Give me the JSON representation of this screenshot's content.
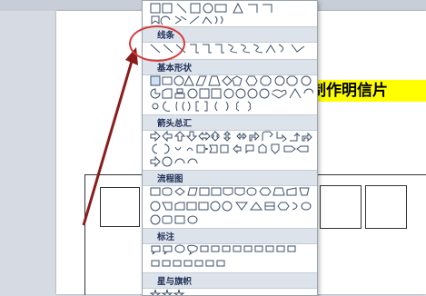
{
  "document": {
    "title_text": "制作明信片"
  },
  "shapes_menu": {
    "sections": [
      {
        "label": "线条"
      },
      {
        "label": "基本形状"
      },
      {
        "label": "箭头总汇"
      },
      {
        "label": "流程图"
      },
      {
        "label": "标注"
      },
      {
        "label": "星与旗帜"
      }
    ]
  },
  "colors": {
    "highlight_yellow": "#ffff00",
    "annotation_red": "#d63b3b",
    "section_header_bg": "#dde3ea"
  }
}
